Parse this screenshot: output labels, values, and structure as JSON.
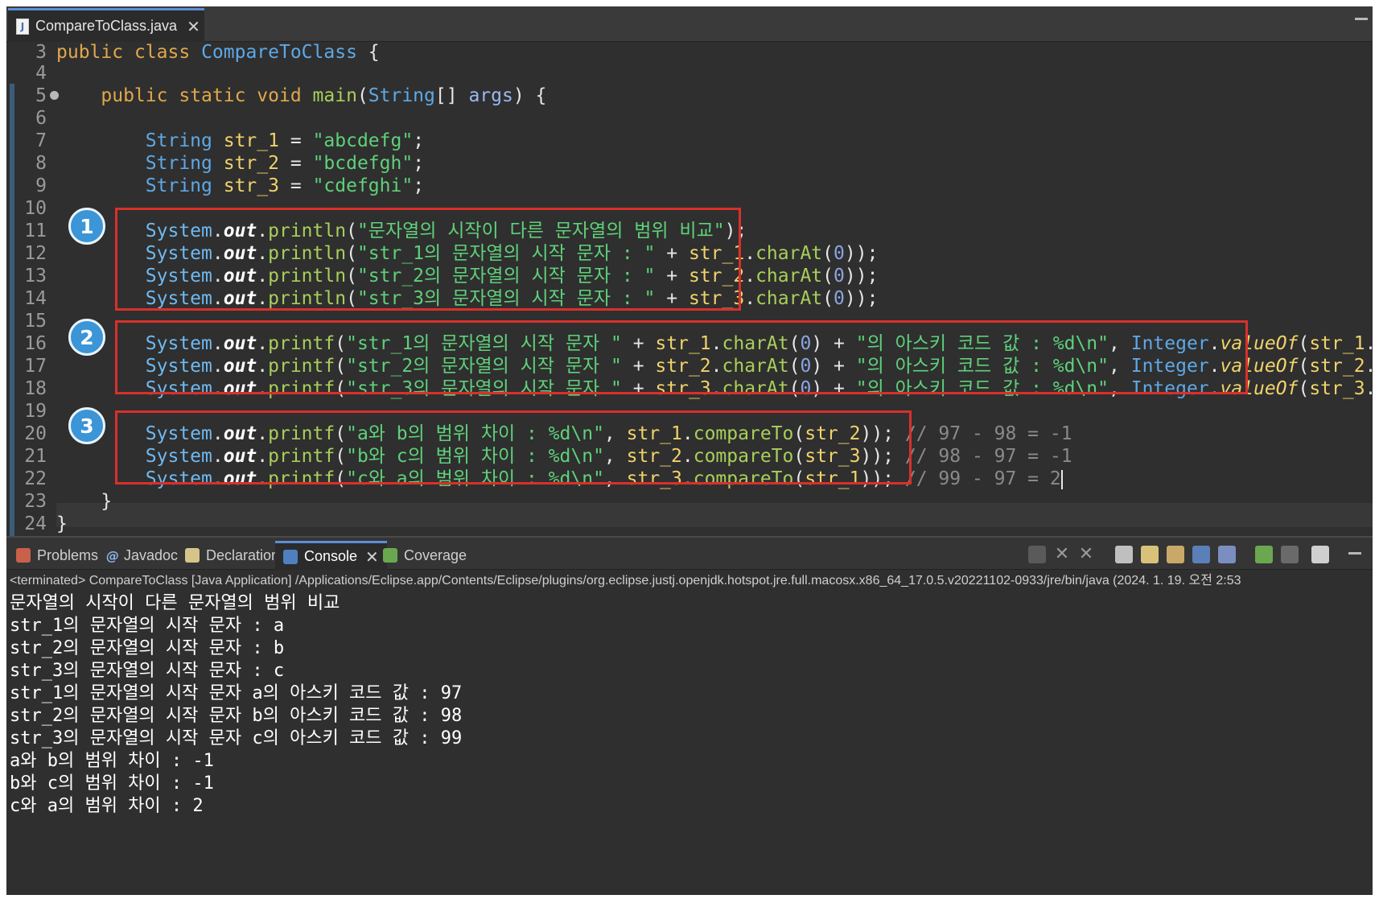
{
  "editor": {
    "tab_title": "CompareToClass.java",
    "file_icon_glyph": "J",
    "close_glyph": "✕",
    "active_line": 22,
    "line_numbers": [
      "3",
      "4",
      "5",
      "6",
      "7",
      "8",
      "9",
      "10",
      "11",
      "12",
      "13",
      "14",
      "15",
      "16",
      "17",
      "18",
      "19",
      "20",
      "21",
      "22",
      "23",
      "24"
    ]
  },
  "code": {
    "l3": [
      "public",
      "class",
      "CompareToClass",
      "{"
    ],
    "l5": [
      "public",
      "static",
      "void",
      "main",
      "(",
      "String",
      "[] ",
      "args",
      ") {"
    ],
    "l7": [
      "String",
      "str_1",
      "=",
      "\"abcdefg\"",
      ";"
    ],
    "l8": [
      "String",
      "str_2",
      "=",
      "\"bcdefgh\"",
      ";"
    ],
    "l9": [
      "String",
      "str_3",
      "=",
      "\"cdefghi\"",
      ";"
    ],
    "system": "System",
    "out": "out",
    "println": "println",
    "printf": "printf",
    "charAt": "charAt",
    "compareTo": "compareTo",
    "integer": "Integer",
    "valueOf": "valueOf",
    "zero": "0",
    "l11_str": "\"문자열의 시작이 다른 문자열의 범위 비교\"",
    "l12_str": "\"str_1의 문자열의 시작 문자 : \"",
    "l13_str": "\"str_2의 문자열의 시작 문자 : \"",
    "l14_str": "\"str_3의 문자열의 시작 문자 : \"",
    "l16_str": "\"str_1의 문자열의 시작 문자 \"",
    "l17_str": "\"str_2의 문자열의 시작 문자 \"",
    "l18_str": "\"str_3의 문자열의 시작 문자 \"",
    "ascii_str": "\"의 아스키 코드 값 : %d\\n\"",
    "l20_str": "\"a와 b의 범위 차이 : %d\\n\"",
    "l21_str": "\"b와 c의 범위 차이 : %d\\n\"",
    "l22_str": "\"c와 a의 범위 차이 : %d\\n\"",
    "l20_cmt": "// 97 - 98 = -1",
    "l21_cmt": "// 98 - 97 = -1",
    "l22_cmt": "// 99 - 97 = 2",
    "vars": [
      "str_1",
      "str_2",
      "str_3"
    ],
    "close_method": "}",
    "close_class": "}"
  },
  "badges": [
    "1",
    "2",
    "3"
  ],
  "panel": {
    "tabs": [
      "Problems",
      "Javadoc",
      "Declaration",
      "Console",
      "Coverage"
    ],
    "active_tab": "Console"
  },
  "console": {
    "status": "<terminated> CompareToClass [Java Application] /Applications/Eclipse.app/Contents/Eclipse/plugins/org.eclipse.justj.openjdk.hotspot.jre.full.macosx.x86_64_17.0.5.v20221102-0933/jre/bin/java  (2024. 1. 19. 오전 2:53",
    "lines": [
      "문자열의 시작이 다른 문자열의 범위 비교",
      "str_1의 문자열의 시작 문자 : a",
      "str_2의 문자열의 시작 문자 : b",
      "str_3의 문자열의 시작 문자 : c",
      "str_1의 문자열의 시작 문자 a의 아스키 코드 값 : 97",
      "str_2의 문자열의 시작 문자 b의 아스키 코드 값 : 98",
      "str_3의 문자열의 시작 문자 c의 아스키 코드 값 : 99",
      "a와 b의 범위 차이 : -1",
      "b와 c의 범위 차이 : -1",
      "c와 a의 범위 차이 : 2"
    ]
  },
  "colors": {
    "highlight_box": "#d9302b",
    "badge": "#3b95d6",
    "active_tab_accent": "#5b8fd6"
  },
  "icons": {
    "file": "java-file-icon",
    "problems": "problems-icon",
    "javadoc": "javadoc-icon",
    "declaration": "declaration-icon",
    "console": "console-icon",
    "coverage": "coverage-icon"
  }
}
